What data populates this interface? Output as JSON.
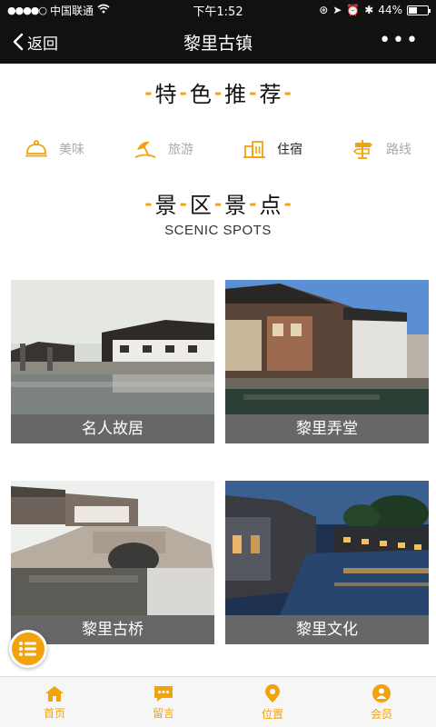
{
  "status": {
    "carrier": "中国联通",
    "time": "下午1:52",
    "battery": "44%",
    "battery_level": 0.44
  },
  "header": {
    "back_label": "返回",
    "title": "黎里古镇",
    "more_label": "•••"
  },
  "featured": {
    "heading": [
      "特",
      "色",
      "推",
      "荐"
    ],
    "categories": [
      {
        "label": "美味",
        "icon": "cloche-icon"
      },
      {
        "label": "旅游",
        "icon": "umbrella-icon"
      },
      {
        "label": "住宿",
        "icon": "building-icon"
      },
      {
        "label": "路线",
        "icon": "signpost-icon"
      }
    ],
    "active_index": 2
  },
  "scenic": {
    "heading": [
      "景",
      "区",
      "景",
      "点"
    ],
    "subtitle": "SCENIC SPOTS",
    "items": [
      {
        "label": "名人故居"
      },
      {
        "label": "黎里弄堂"
      },
      {
        "label": "黎里古桥"
      },
      {
        "label": "黎里文化"
      }
    ]
  },
  "tabbar": {
    "items": [
      {
        "label": "首页",
        "icon": "home-icon"
      },
      {
        "label": "留言",
        "icon": "message-icon"
      },
      {
        "label": "位置",
        "icon": "location-pin-icon"
      },
      {
        "label": "会员",
        "icon": "member-icon"
      }
    ]
  },
  "colors": {
    "accent": "#f2a20c",
    "bar": "#111111",
    "caption_bg": "#676767"
  }
}
